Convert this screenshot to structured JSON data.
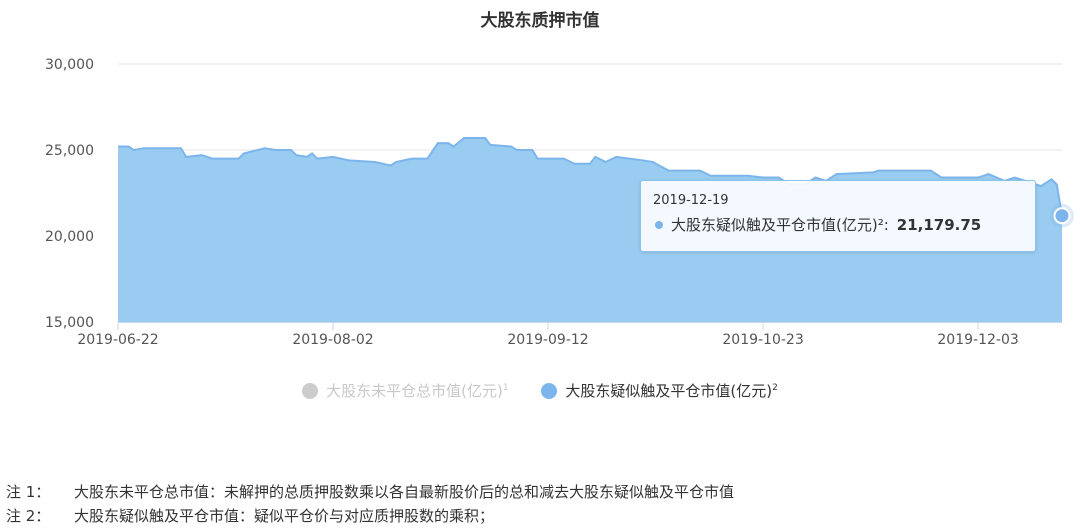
{
  "chart_data": {
    "type": "area",
    "title": "大股东质押市值",
    "x_ticks": [
      "2019-06-22",
      "2019-08-02",
      "2019-09-12",
      "2019-10-23",
      "2019-12-03"
    ],
    "x_range": [
      "2019-06-22",
      "2019-12-19"
    ],
    "y_ticks": [
      "15,000",
      "20,000",
      "25,000",
      "30,000"
    ],
    "ylim": [
      15000,
      30000
    ],
    "grid": "horizontal",
    "legend_position": "bottom",
    "series": [
      {
        "name": "大股东未平仓总市值(亿元)",
        "footnote": "1",
        "visible": false,
        "color": "#cccccc"
      },
      {
        "name": "大股东疑似触及平仓市值(亿元)",
        "footnote": "2",
        "visible": true,
        "color": "#7cb5ec",
        "fill": "#99ccf0",
        "points": [
          [
            "2019-06-22",
            25200
          ],
          [
            "2019-06-24",
            25200
          ],
          [
            "2019-06-25",
            25000
          ],
          [
            "2019-06-27",
            25100
          ],
          [
            "2019-06-30",
            25100
          ],
          [
            "2019-07-04",
            25100
          ],
          [
            "2019-07-05",
            24600
          ],
          [
            "2019-07-08",
            24700
          ],
          [
            "2019-07-10",
            24500
          ],
          [
            "2019-07-15",
            24500
          ],
          [
            "2019-07-16",
            24800
          ],
          [
            "2019-07-20",
            25100
          ],
          [
            "2019-07-22",
            25000
          ],
          [
            "2019-07-25",
            25000
          ],
          [
            "2019-07-26",
            24700
          ],
          [
            "2019-07-28",
            24600
          ],
          [
            "2019-07-29",
            24800
          ],
          [
            "2019-07-30",
            24500
          ],
          [
            "2019-08-02",
            24600
          ],
          [
            "2019-08-05",
            24400
          ],
          [
            "2019-08-10",
            24300
          ],
          [
            "2019-08-13",
            24100
          ],
          [
            "2019-08-14",
            24300
          ],
          [
            "2019-08-17",
            24500
          ],
          [
            "2019-08-20",
            24500
          ],
          [
            "2019-08-22",
            25400
          ],
          [
            "2019-08-24",
            25400
          ],
          [
            "2019-08-25",
            25200
          ],
          [
            "2019-08-27",
            25700
          ],
          [
            "2019-08-31",
            25700
          ],
          [
            "2019-09-01",
            25300
          ],
          [
            "2019-09-05",
            25200
          ],
          [
            "2019-09-06",
            25000
          ],
          [
            "2019-09-09",
            25000
          ],
          [
            "2019-09-10",
            24500
          ],
          [
            "2019-09-15",
            24500
          ],
          [
            "2019-09-17",
            24200
          ],
          [
            "2019-09-20",
            24200
          ],
          [
            "2019-09-21",
            24600
          ],
          [
            "2019-09-23",
            24300
          ],
          [
            "2019-09-25",
            24600
          ],
          [
            "2019-09-30",
            24400
          ],
          [
            "2019-10-02",
            24300
          ],
          [
            "2019-10-05",
            23800
          ],
          [
            "2019-10-11",
            23800
          ],
          [
            "2019-10-13",
            23500
          ],
          [
            "2019-10-20",
            23500
          ],
          [
            "2019-10-23",
            23400
          ],
          [
            "2019-10-26",
            23400
          ],
          [
            "2019-10-28",
            23000
          ],
          [
            "2019-10-31",
            23000
          ],
          [
            "2019-11-02",
            23400
          ],
          [
            "2019-11-04",
            23200
          ],
          [
            "2019-11-06",
            23600
          ],
          [
            "2019-11-13",
            23700
          ],
          [
            "2019-11-14",
            23800
          ],
          [
            "2019-11-24",
            23800
          ],
          [
            "2019-11-26",
            23400
          ],
          [
            "2019-12-03",
            23400
          ],
          [
            "2019-12-05",
            23600
          ],
          [
            "2019-12-08",
            23200
          ],
          [
            "2019-12-10",
            23400
          ],
          [
            "2019-12-12",
            23200
          ],
          [
            "2019-12-15",
            22900
          ],
          [
            "2019-12-17",
            23300
          ],
          [
            "2019-12-18",
            23000
          ],
          [
            "2019-12-19",
            21179.75
          ]
        ]
      }
    ],
    "tooltip": {
      "date": "2019-12-19",
      "label": "大股东疑似触及平仓市值(亿元)²:",
      "value": "21,179.75"
    }
  },
  "notes": [
    {
      "tag": "注 1：",
      "text": "大股东未平仓总市值：未解押的总质押股数乘以各自最新股价后的总和减去大股东疑似触及平仓市值"
    },
    {
      "tag": "注 2：",
      "text": "大股东疑似触及平仓市值：疑似平仓价与对应质押股数的乘积；"
    }
  ]
}
